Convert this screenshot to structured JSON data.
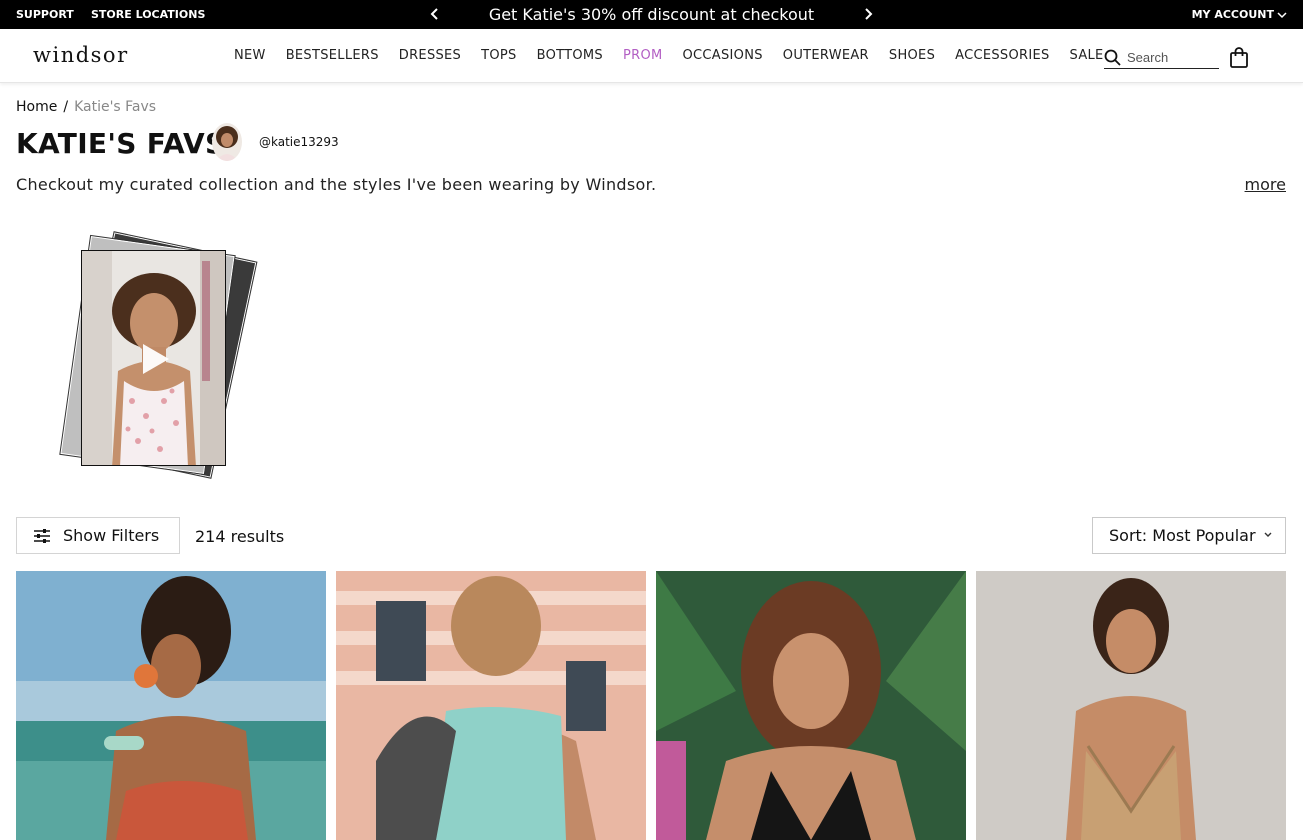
{
  "topbar": {
    "support": "SUPPORT",
    "store_locations": "STORE LOCATIONS",
    "promo": "Get Katie's 30% off discount at checkout",
    "my_account": "MY ACCOUNT"
  },
  "header": {
    "logo": "windsor",
    "nav": [
      "NEW",
      "BESTSELLERS",
      "DRESSES",
      "TOPS",
      "BOTTOMS",
      "PROM",
      "OCCASIONS",
      "OUTERWEAR",
      "SHOES",
      "ACCESSORIES",
      "SALE"
    ],
    "search_placeholder": "Search",
    "highlight_color": "#b35fc4"
  },
  "breadcrumb": {
    "home": "Home",
    "separator": "/",
    "current": "Katie's Favs"
  },
  "page": {
    "title": "KATIE'S FAVS",
    "handle": "@katie13293",
    "description": "Checkout my curated collection and the styles I've been wearing by Windsor.",
    "more": "more"
  },
  "toolbar": {
    "filters_label": "Show Filters",
    "results": "214 results",
    "sort_label": "Sort: Most Popular"
  },
  "icons": {
    "search": "search-icon",
    "bag": "shopping-bag-icon",
    "filters": "sliders-icon",
    "play": "play-icon",
    "prev": "chevron-left-icon",
    "next": "chevron-right-icon"
  }
}
